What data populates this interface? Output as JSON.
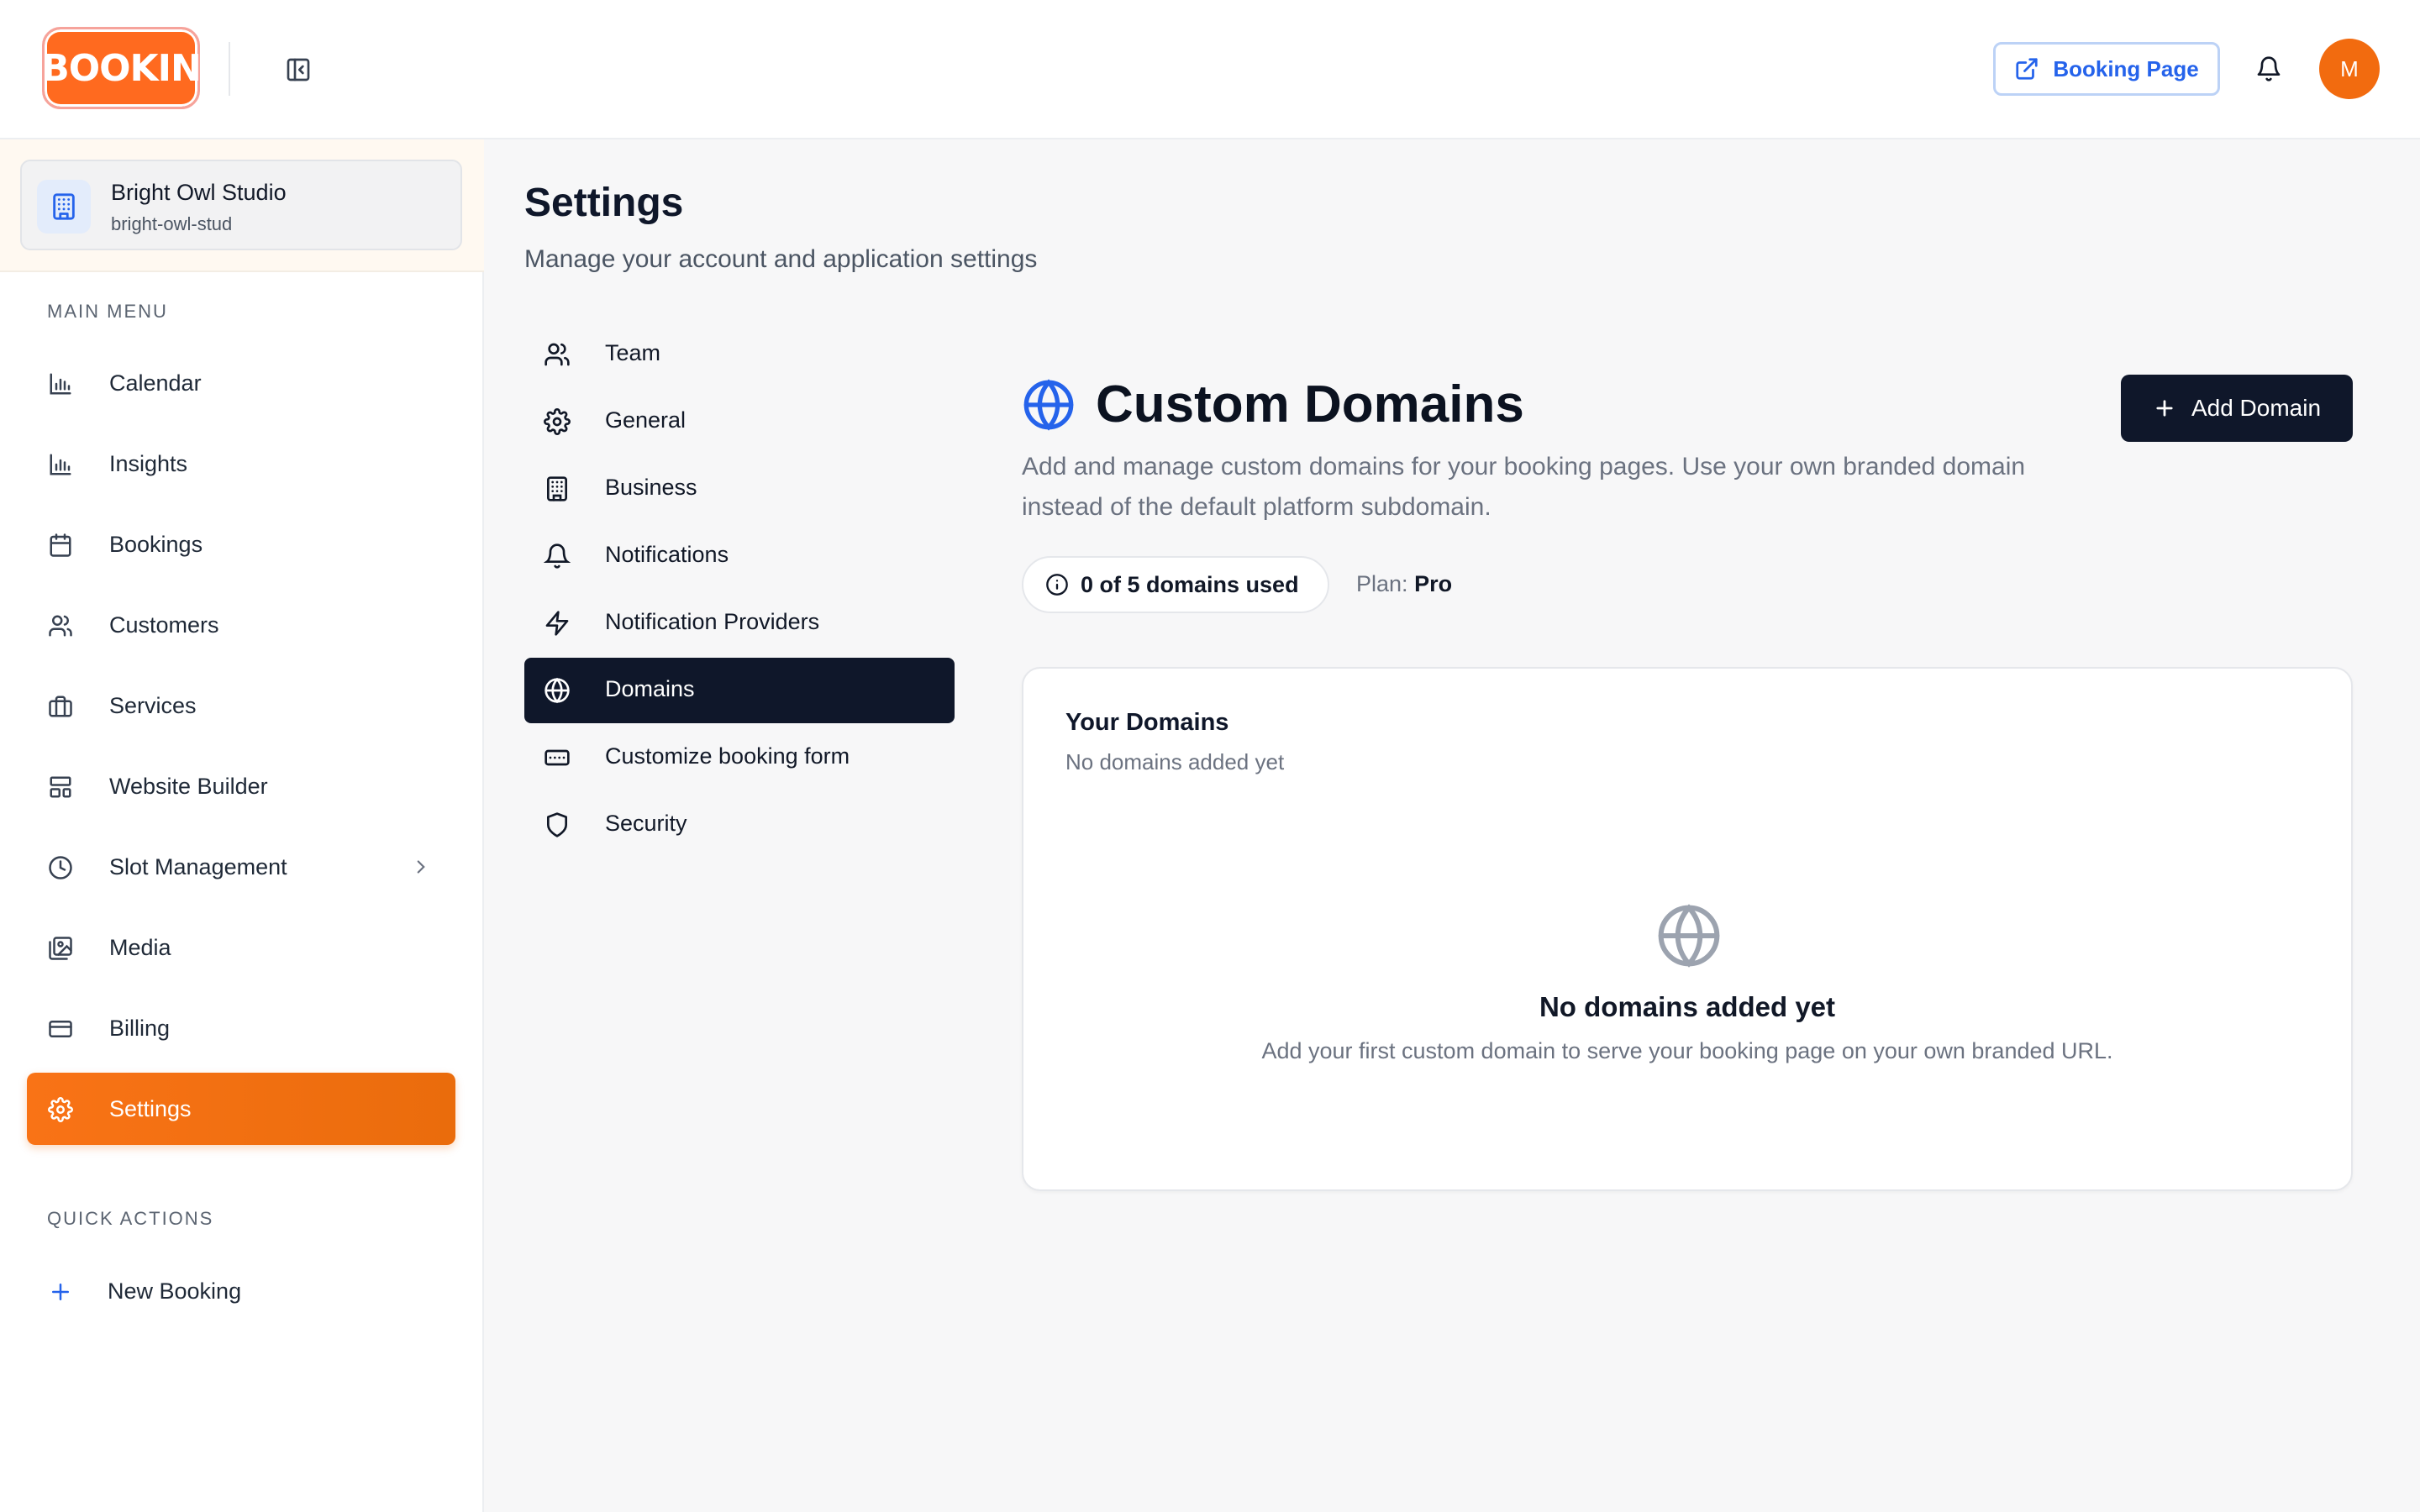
{
  "header": {
    "logo_text": "BOOKIN",
    "booking_page_label": "Booking Page",
    "avatar_initial": "M"
  },
  "sidebar": {
    "org": {
      "name": "Bright Owl Studio",
      "slug": "bright-owl-stud"
    },
    "main_menu_label": "MAIN MENU",
    "items": [
      {
        "label": "Calendar",
        "icon": "chart-bars-icon"
      },
      {
        "label": "Insights",
        "icon": "chart-bars-icon"
      },
      {
        "label": "Bookings",
        "icon": "calendar-icon"
      },
      {
        "label": "Customers",
        "icon": "users-icon"
      },
      {
        "label": "Services",
        "icon": "briefcase-icon"
      },
      {
        "label": "Website Builder",
        "icon": "layout-icon"
      },
      {
        "label": "Slot Management",
        "icon": "clock-icon"
      },
      {
        "label": "Media",
        "icon": "images-icon"
      },
      {
        "label": "Billing",
        "icon": "credit-card-icon"
      },
      {
        "label": "Settings",
        "icon": "gear-icon",
        "active": true
      }
    ],
    "quick_actions_label": "QUICK ACTIONS",
    "new_booking_label": "New Booking"
  },
  "page": {
    "title": "Settings",
    "subtitle": "Manage your account and application settings"
  },
  "settings_nav": [
    {
      "label": "Team",
      "icon": "users-icon"
    },
    {
      "label": "General",
      "icon": "gear-icon"
    },
    {
      "label": "Business",
      "icon": "building-icon"
    },
    {
      "label": "Notifications",
      "icon": "bell-icon"
    },
    {
      "label": "Notification Providers",
      "icon": "lightning-icon"
    },
    {
      "label": "Domains",
      "icon": "globe-icon",
      "active": true
    },
    {
      "label": "Customize booking form",
      "icon": "form-icon"
    },
    {
      "label": "Security",
      "icon": "shield-icon"
    }
  ],
  "custom_domains": {
    "title": "Custom Domains",
    "description": "Add and manage custom domains for your booking pages. Use your own branded domain instead of the default platform subdomain.",
    "add_button_label": "Add Domain",
    "usage_text": "0 of 5 domains used",
    "plan_label": "Plan:",
    "plan_value": "Pro",
    "card": {
      "title": "Your Domains",
      "subtitle": "No domains added yet",
      "empty_title": "No domains added yet",
      "empty_description": "Add your first custom domain to serve your booking page on your own branded URL."
    }
  },
  "colors": {
    "accent_orange": "#f97316",
    "dark": "#0f172a",
    "link_blue": "#2563eb"
  }
}
